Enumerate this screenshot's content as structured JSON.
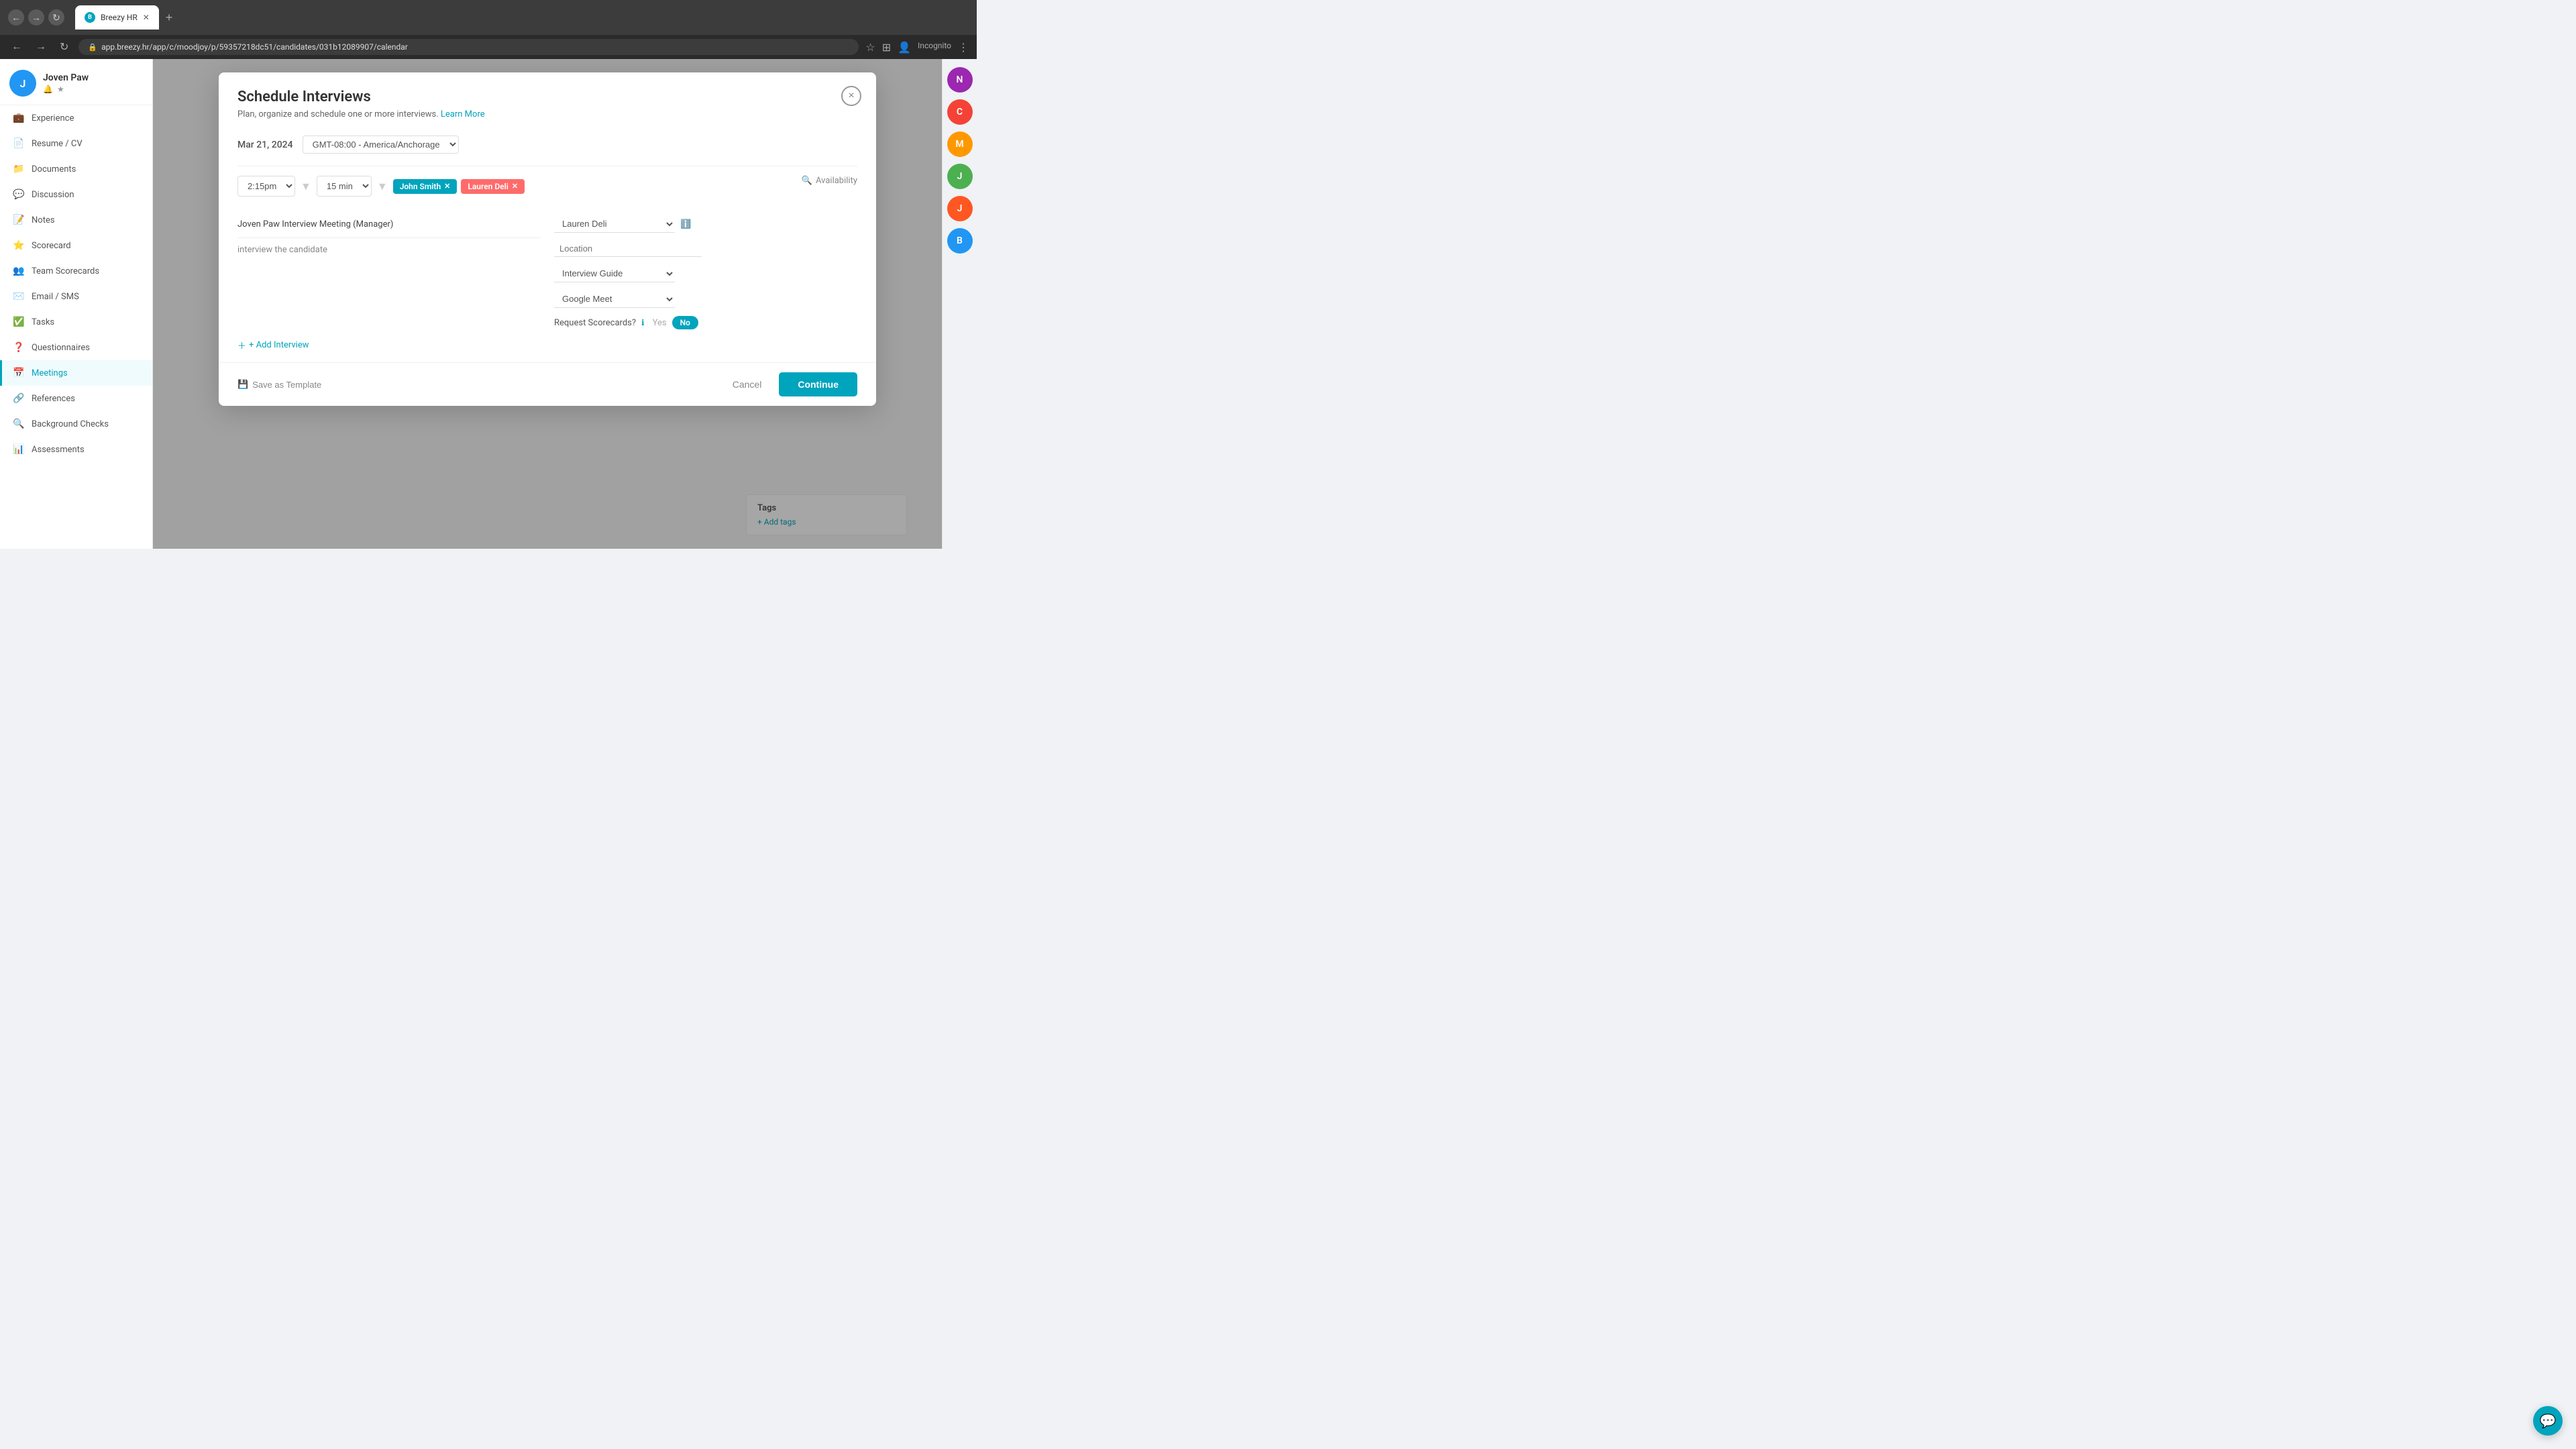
{
  "browser": {
    "url": "app.breezy.hr/app/c/moodjoy/p/59357218dc51/candidates/031b12089907/calendar",
    "tab_label": "Breezy HR",
    "new_tab_label": "+"
  },
  "candidate": {
    "name": "Joven Paw",
    "initials": "J"
  },
  "sidebar": {
    "items": [
      {
        "id": "experience",
        "label": "Experience",
        "icon": "💼"
      },
      {
        "id": "resume",
        "label": "Resume / CV",
        "icon": "📄"
      },
      {
        "id": "documents",
        "label": "Documents",
        "icon": "📁"
      },
      {
        "id": "discussion",
        "label": "Discussion",
        "icon": "💬"
      },
      {
        "id": "notes",
        "label": "Notes",
        "icon": "📝"
      },
      {
        "id": "scorecard",
        "label": "Scorecard",
        "icon": "⭐"
      },
      {
        "id": "team-scorecards",
        "label": "Team Scorecards",
        "icon": "👥"
      },
      {
        "id": "email-sms",
        "label": "Email / SMS",
        "icon": "✉️"
      },
      {
        "id": "tasks",
        "label": "Tasks",
        "icon": "✅"
      },
      {
        "id": "questionnaires",
        "label": "Questionnaires",
        "icon": "❓"
      },
      {
        "id": "meetings",
        "label": "Meetings",
        "icon": "📅",
        "active": true
      },
      {
        "id": "references",
        "label": "References",
        "icon": "🔗"
      },
      {
        "id": "background-checks",
        "label": "Background Checks",
        "icon": "🔍"
      },
      {
        "id": "assessments",
        "label": "Assessments",
        "icon": "📊"
      }
    ]
  },
  "modal": {
    "title": "Schedule Interviews",
    "subtitle": "Plan, organize and schedule one or more interviews.",
    "learn_more": "Learn More",
    "date": "Mar 21, 2024",
    "timezone": "GMT-08:00 - America/Anchorage",
    "time": "2:15pm",
    "duration": "15 min",
    "interviewers": [
      {
        "name": "John Smith",
        "color": "#00a4bd"
      },
      {
        "name": "Lauren Deli",
        "color": "#ff6b6b"
      }
    ],
    "availability_label": "Availability",
    "meeting_title": "Joven Paw Interview Meeting (Manager)",
    "meeting_notes": "interview the candidate",
    "organizer": "Lauren Deli",
    "location_placeholder": "Location",
    "interview_guide_placeholder": "Interview Guide",
    "video_platform": "Google Meet",
    "request_scorecards_label": "Request Scorecards?",
    "scorecard_yes": "Yes",
    "scorecard_no": "No",
    "add_interview_label": "+ Add Interview",
    "save_template_label": "Save as Template",
    "cancel_label": "Cancel",
    "continue_label": "Continue",
    "close_label": "×"
  },
  "right_panel": {
    "avatars": [
      {
        "initials": "N",
        "color": "#9c27b0"
      },
      {
        "initials": "C",
        "color": "#f44336"
      },
      {
        "initials": "M",
        "color": "#ff9800"
      },
      {
        "initials": "J",
        "color": "#4caf50"
      },
      {
        "initials": "J",
        "color": "#ff5722"
      },
      {
        "initials": "B",
        "color": "#2196f3"
      }
    ]
  },
  "tags": {
    "label": "Tags",
    "add_label": "+ Add tags"
  }
}
